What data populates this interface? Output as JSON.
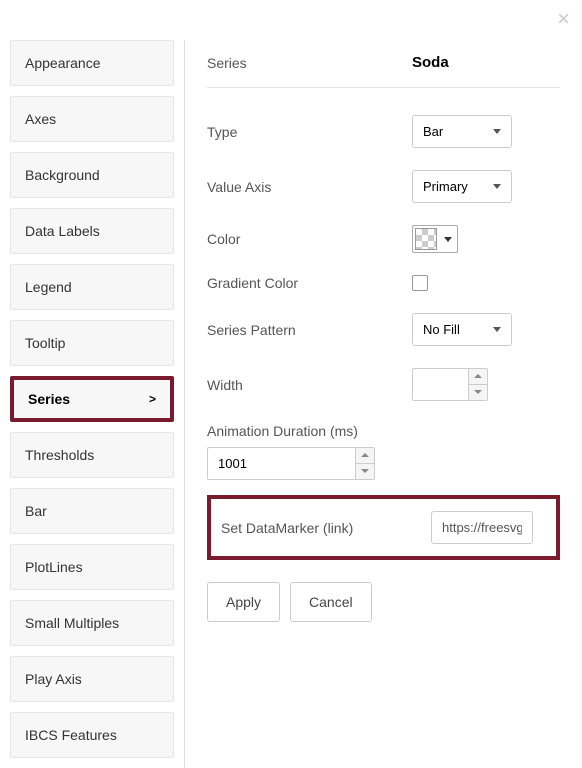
{
  "close_glyph": "×",
  "tabs": [
    {
      "label": "Appearance",
      "active": false
    },
    {
      "label": "Axes",
      "active": false
    },
    {
      "label": "Background",
      "active": false
    },
    {
      "label": "Data Labels",
      "active": false
    },
    {
      "label": "Legend",
      "active": false
    },
    {
      "label": "Tooltip",
      "active": false
    },
    {
      "label": "Series",
      "active": true
    },
    {
      "label": "Thresholds",
      "active": false
    },
    {
      "label": "Bar",
      "active": false
    },
    {
      "label": "PlotLines",
      "active": false
    },
    {
      "label": "Small Multiples",
      "active": false
    },
    {
      "label": "Play Axis",
      "active": false
    },
    {
      "label": "IBCS Features",
      "active": false
    }
  ],
  "header": {
    "label": "Series",
    "value": "Soda"
  },
  "fields": {
    "type": {
      "label": "Type",
      "value": "Bar"
    },
    "valueAxis": {
      "label": "Value Axis",
      "value": "Primary"
    },
    "color": {
      "label": "Color"
    },
    "gradient": {
      "label": "Gradient Color"
    },
    "pattern": {
      "label": "Series Pattern",
      "value": "No Fill"
    },
    "width": {
      "label": "Width",
      "value": ""
    },
    "animation": {
      "label": "Animation Duration (ms)",
      "value": "1001"
    },
    "datamarker": {
      "label": "Set DataMarker (link)",
      "value": "https://freesvg."
    }
  },
  "buttons": {
    "apply": "Apply",
    "cancel": "Cancel"
  }
}
